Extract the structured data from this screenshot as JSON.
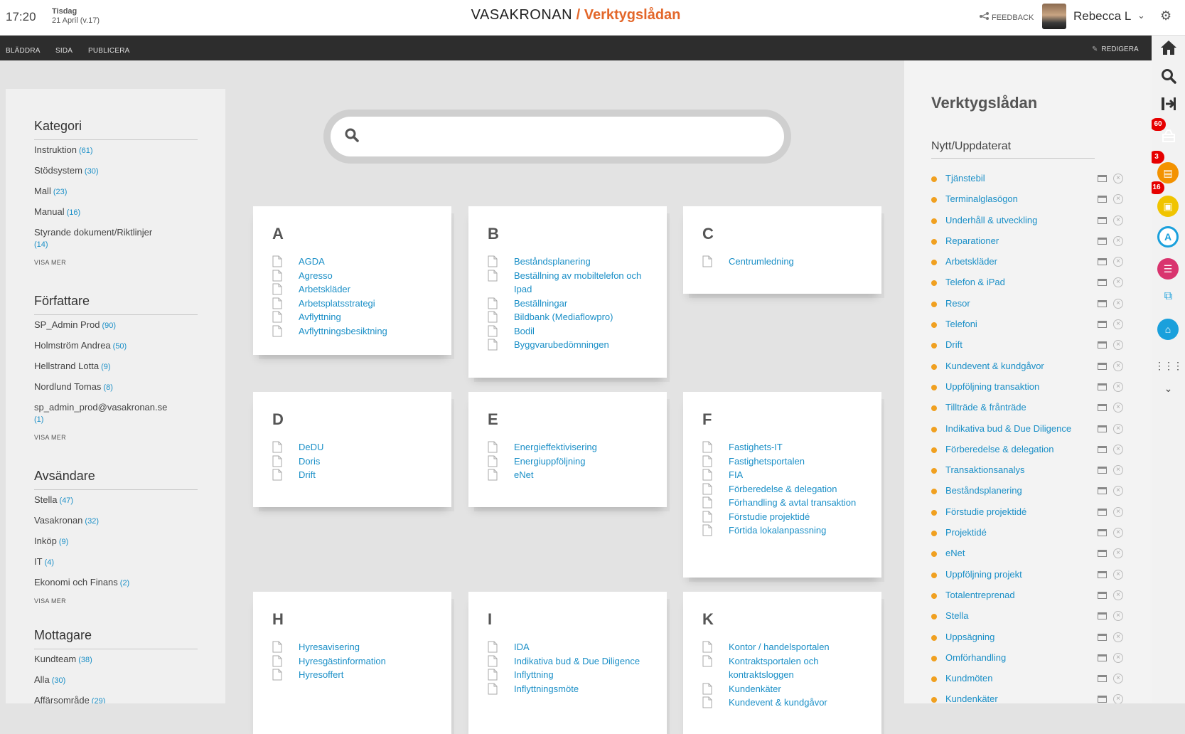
{
  "topbar": {
    "time": "17:20",
    "weekday": "Tisdag",
    "date": "21 April (v.17)",
    "brand_name": "VASAKRONAN",
    "brand_sep": " / ",
    "app_name": "Verktygslådan",
    "feedback": "FEEDBACK",
    "user": "Rebecca L"
  },
  "commandbar": {
    "items": [
      "BLÄDDRA",
      "SIDA",
      "PUBLICERA"
    ],
    "edit": "REDIGERA"
  },
  "rail": {
    "badges": [
      "60",
      "3",
      "16"
    ],
    "colors": {
      "active": "#e3672a",
      "orange": "#f39200",
      "yellow": "#f0c400",
      "blue": "#1aa0dc",
      "magenta": "#d9346e",
      "teal": "#1aa0dc"
    }
  },
  "filters": {
    "kategori": {
      "title": "Kategori",
      "items": [
        {
          "label": "Instruktion",
          "count": "(61)"
        },
        {
          "label": "Stödsystem",
          "count": "(30)"
        },
        {
          "label": "Mall",
          "count": "(23)"
        },
        {
          "label": "Manual",
          "count": "(16)"
        },
        {
          "label": "Styrande dokument/Riktlinjer",
          "count": "(14)"
        }
      ],
      "more": "VISA MER"
    },
    "forfattare": {
      "title": "Författare",
      "items": [
        {
          "label": "SP_Admin Prod",
          "count": "(90)"
        },
        {
          "label": "Holmström Andrea",
          "count": "(50)"
        },
        {
          "label": "Hellstrand Lotta",
          "count": "(9)"
        },
        {
          "label": "Nordlund Tomas",
          "count": "(8)"
        },
        {
          "label": "sp_admin_prod@vasakronan.se",
          "count": "(1)"
        }
      ],
      "more": "VISA MER"
    },
    "avsandare": {
      "title": "Avsändare",
      "items": [
        {
          "label": "Stella",
          "count": "(47)"
        },
        {
          "label": "Vasakronan",
          "count": "(32)"
        },
        {
          "label": "Inköp",
          "count": "(9)"
        },
        {
          "label": "IT",
          "count": "(4)"
        },
        {
          "label": "Ekonomi och Finans",
          "count": "(2)"
        }
      ],
      "more": "VISA MER"
    },
    "mottagare": {
      "title": "Mottagare",
      "items": [
        {
          "label": "Kundteam",
          "count": "(38)"
        },
        {
          "label": "Alla",
          "count": "(30)"
        },
        {
          "label": "Affärsområde",
          "count": "(29)"
        }
      ]
    }
  },
  "search": {
    "placeholder": ""
  },
  "cards": [
    {
      "letter": "A",
      "items": [
        "AGDA",
        "Agresso",
        "Arbetskläder",
        "Arbetsplatsstrategi",
        "Avflyttning",
        "Avflyttningsbesiktning"
      ]
    },
    {
      "letter": "B",
      "items": [
        "Beståndsplanering",
        "Beställning av mobiltelefon och Ipad",
        "Beställningar",
        "Bildbank (Mediaflowpro)",
        "Bodil",
        "Byggvarubedömningen"
      ]
    },
    {
      "letter": "C",
      "items": [
        "Centrumledning"
      ]
    },
    {
      "letter": "D",
      "items": [
        "DeDU",
        "Doris",
        "Drift"
      ]
    },
    {
      "letter": "E",
      "items": [
        "Energieffektivisering",
        "Energiuppföljning",
        "eNet"
      ]
    },
    {
      "letter": "F",
      "items": [
        "Fastighets-IT",
        "Fastighetsportalen",
        "FIA",
        "Förberedelse & delegation",
        "Förhandling & avtal transaktion",
        "Förstudie projektidé",
        "Förtida lokalanpassning"
      ]
    },
    {
      "letter": "H",
      "items": [
        "Hyresavisering",
        "Hyresgästinformation",
        "Hyresoffert"
      ]
    },
    {
      "letter": "I",
      "items": [
        "IDA",
        "Indikativa bud & Due Diligence",
        "Inflyttning",
        "Inflyttningsmöte"
      ]
    },
    {
      "letter": "K",
      "items": [
        "Kontor / handelsportalen",
        "Kontraktsportalen och kontraktsloggen",
        "Kundenkäter",
        "Kundevent & kundgåvor"
      ]
    }
  ],
  "toolbox": {
    "title": "Verktygslådan",
    "subtitle": "Nytt/Uppdaterat",
    "items": [
      "Tjänstebil",
      "Terminalglasögon",
      "Underhåll & utveckling",
      "Reparationer",
      "Arbetskläder",
      "Telefon & iPad",
      "Resor",
      "Telefoni",
      "Drift",
      "Kundevent & kundgåvor",
      "Uppföljning transaktion",
      "Tillträde & frånträde",
      "Indikativa bud & Due Diligence",
      "Förberedelse & delegation",
      "Transaktionsanalys",
      "Beståndsplanering",
      "Förstudie projektidé",
      "Projektidé",
      "eNet",
      "Uppföljning projekt",
      "Totalentreprenad",
      "Stella",
      "Uppsägning",
      "Omförhandling",
      "Kundmöten",
      "Kundenkäter"
    ]
  }
}
